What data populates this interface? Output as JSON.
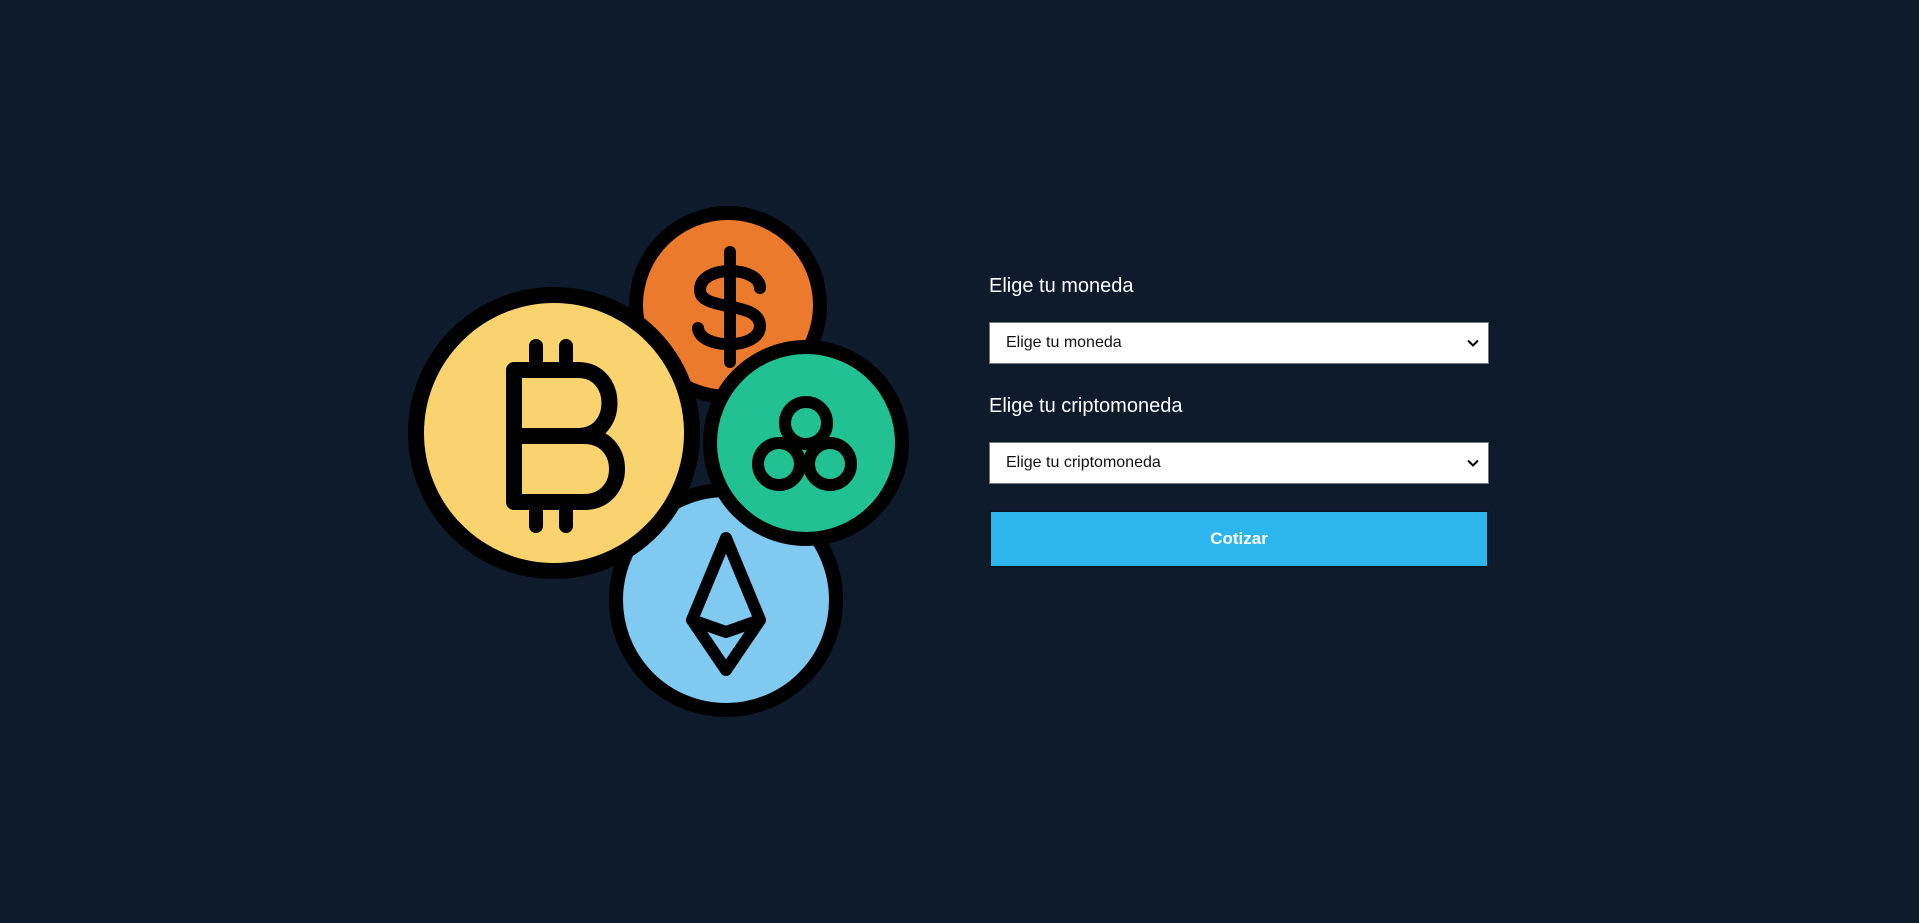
{
  "illustration": {
    "coins": [
      {
        "icon": "bitcoin-icon",
        "color": "#f9d46e"
      },
      {
        "icon": "dollar-icon",
        "color": "#ec7a2c"
      },
      {
        "icon": "cluster-coin-icon",
        "color": "#21c193"
      },
      {
        "icon": "ethereum-icon",
        "color": "#80c9f1"
      }
    ]
  },
  "form": {
    "currency": {
      "label": "Elige tu moneda",
      "selected": "Elige tu moneda"
    },
    "crypto": {
      "label": "Elige tu criptomoneda",
      "selected": "Elige tu criptomoneda"
    },
    "submit_label": "Cotizar"
  },
  "colors": {
    "background": "#0d1b2c",
    "button": "#2db5ed"
  }
}
